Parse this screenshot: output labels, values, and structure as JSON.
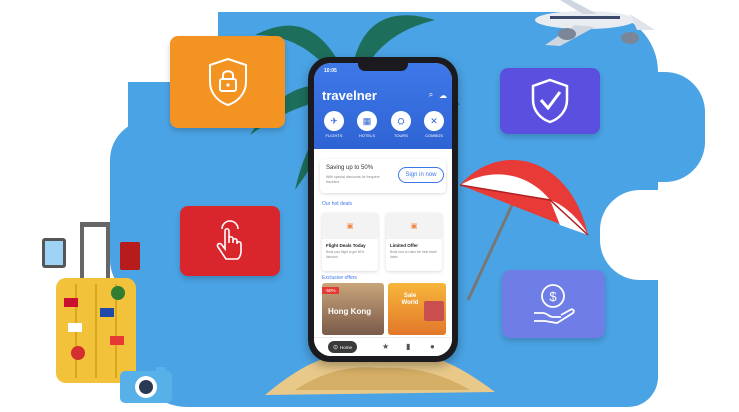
{
  "app": {
    "status_time": "10:05",
    "logo": "travelner",
    "search_icon": "search-icon",
    "bell_icon": "bell-icon"
  },
  "categories": [
    {
      "label": "FLIGHTS",
      "icon": "plane-icon",
      "glyph": "✈"
    },
    {
      "label": "HOTELS",
      "icon": "hotel-icon",
      "glyph": "▦"
    },
    {
      "label": "TOURS",
      "icon": "tour-icon",
      "glyph": "⛭"
    },
    {
      "label": "COMBOS",
      "icon": "combo-icon",
      "glyph": "✕"
    }
  ],
  "promo": {
    "title": "Saving up to 50%",
    "subtitle": "With special discounts for frequent travelers",
    "signin_label": "Sign in now"
  },
  "hot_deals": {
    "heading": "Our hot deals",
    "items": [
      {
        "title": "Flight Deals Today",
        "subtitle": "Book your flight to get 50% discount"
      },
      {
        "title": "Limited Offer",
        "subtitle": "Book now to claim the best travel deals"
      }
    ]
  },
  "exclusive": {
    "heading": "Exclusive offers",
    "items": [
      {
        "badge": "-50%",
        "title": "Hong Kong"
      },
      {
        "badge": "",
        "title": "Sale World"
      }
    ]
  },
  "bottom_nav": {
    "home_label": "Home",
    "items": [
      "home-icon",
      "star-icon",
      "bag-icon",
      "user-icon"
    ]
  },
  "colors": {
    "sky": "#4aa3e4",
    "card_orange": "#f39322",
    "card_red": "#d9262d",
    "card_purple": "#5b4fe0",
    "card_lavender": "#6f7ee6",
    "brand_blue": "#2f63d4"
  }
}
